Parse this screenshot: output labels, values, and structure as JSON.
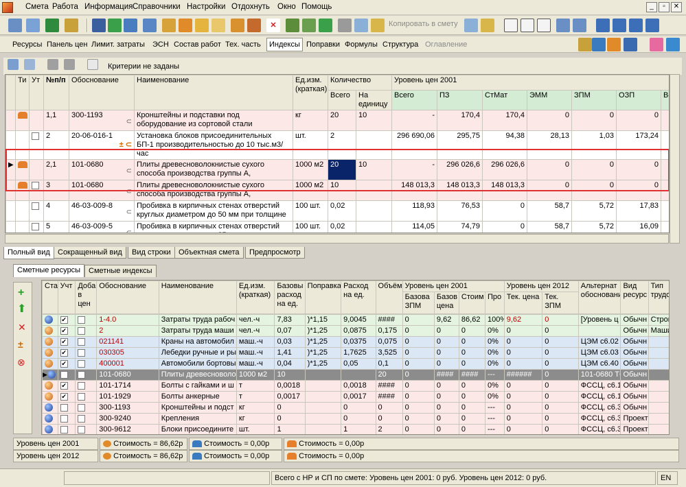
{
  "menu": [
    "Смета",
    "Работа",
    "Информация",
    "Справочники",
    "Настройки",
    "Отдохнуть",
    "Окно",
    "Помощь"
  ],
  "window_buttons": [
    "_",
    "▫",
    "✕"
  ],
  "toolbar": {
    "copy_label": "Копировать в смету"
  },
  "nav": {
    "items": [
      "Ресурсы",
      "Панель цен",
      "Лимит. затраты",
      "ЭСН",
      "Состав работ",
      "Тех. часть",
      "Индексы",
      "Поправки",
      "Формулы",
      "Структура",
      "Оглавление"
    ],
    "active": "Индексы",
    "disabled": "Оглавление"
  },
  "criteria_label": "Критерии не заданы",
  "upper": {
    "headers": {
      "ti": "Ти",
      "ut": "Ут",
      "npp": "№п/п",
      "obosn": "Обоснование",
      "name": "Наименование",
      "unit": "Ед.изм. (краткая)",
      "qty": "Количество",
      "qty_total": "Всего",
      "qty_per": "На единицу",
      "level": "Уровень цен 2001",
      "vsego": "Всего",
      "pz": "ПЗ",
      "stmat": "СтМат",
      "emm": "ЭММ",
      "zpm": "ЗПМ",
      "ozp": "ОЗП",
      "vo": "Во"
    },
    "rows": [
      {
        "npp": "1,1",
        "obosn": "300-1193",
        "name": "Кронштейны и подставки под оборудование из сортовой стали",
        "unit": "кг",
        "qty": "20",
        "per": "10",
        "vsego": "-",
        "pz": "170,4",
        "stmat": "170,4",
        "emm": "0",
        "zpm": "0",
        "ozp": "0"
      },
      {
        "npp": "2",
        "obosn": "20-06-016-1",
        "name": "Установка блоков присоединительных БП-1 производительностью до 10 тыс.м3/час",
        "unit": "шт.",
        "qty": "2",
        "per": "",
        "vsego": "296 690,06",
        "pz": "295,75",
        "stmat": "94,38",
        "emm": "28,13",
        "zpm": "1,03",
        "ozp": "173,24"
      },
      {
        "npp": "2,1",
        "obosn": "101-0680",
        "name": "Плиты древесноволокнистые сухого способа производства группы А,",
        "unit": "1000 м2",
        "qty": "20",
        "per": "10",
        "vsego": "-",
        "pz": "296 026,6",
        "stmat": "296 026,6",
        "emm": "0",
        "zpm": "0",
        "ozp": "0"
      },
      {
        "npp": "3",
        "obosn": "101-0680",
        "name": "Плиты древесноволокнистые сухого способа производства группы А,",
        "unit": "1000 м2",
        "qty": "10",
        "per": "",
        "vsego": "148 013,3",
        "pz": "148 013,3",
        "stmat": "148 013,3",
        "emm": "0",
        "zpm": "0",
        "ozp": "0"
      },
      {
        "npp": "4",
        "obosn": "46-03-009-8",
        "name": "Пробивка в кирпичных стенах отверстий круглых диаметром до 50 мм при толщине",
        "unit": "100 шт.",
        "qty": "0,02",
        "per": "",
        "vsego": "118,93",
        "pz": "76,53",
        "stmat": "0",
        "emm": "58,7",
        "zpm": "5,72",
        "ozp": "17,83"
      },
      {
        "npp": "5",
        "obosn": "46-03-009-5",
        "name": "Пробивка в кирпичных стенах отверстий круглых диаметром до 25 мм при толщине",
        "unit": "100 шт.",
        "qty": "0,02",
        "per": "",
        "vsego": "114,05",
        "pz": "74,79",
        "stmat": "0",
        "emm": "58,7",
        "zpm": "5,72",
        "ozp": "16,09"
      }
    ]
  },
  "view_tabs": [
    "Полный вид",
    "Сокращенный вид",
    "Вид строки",
    "Объектная смета",
    "Предпросмотр"
  ],
  "lower_tabs": [
    "Сметные ресурсы",
    "Сметные индексы"
  ],
  "lower": {
    "headers": {
      "stat": "Ста",
      "ucht": "Учт",
      "doba": "Доба в цен",
      "obosn": "Обоснование",
      "name": "Наименование",
      "unit": "Ед.изм. (краткая)",
      "base": "Базовы расход на ед.",
      "popr": "Поправка",
      "rashod": "Расход на ед.",
      "obem": "Объём",
      "lvl2001": "Уровень цен 2001",
      "bzpm": "Базова ЗПМ",
      "bprice": "Базов цена",
      "stoim": "Стоим",
      "pro": "Про",
      "lvl2012": "Уровень цен 2012",
      "tprice": "Тек. цена",
      "tzpm": "Тек. ЗПМ",
      "alt": "Альтернат обосновани",
      "vid": "Вид ресурс",
      "tip": "Тип трудоза"
    },
    "rows": [
      {
        "obosn": "1-4.0",
        "name": "Затраты труда рабоч",
        "unit": "чел.-ч",
        "base": "7,83",
        "popr": ")*1,15",
        "rashod": "9,0045",
        "obem": "####",
        "bzpm": "0",
        "bprice": "9,62",
        "stoim": "86,62",
        "pro": "100%",
        "tprice": "9,62",
        "tzpm": "0",
        "alt": "[Уровень ц",
        "vid": "Обычн",
        "tip": "Строите"
      },
      {
        "obosn": "2",
        "name": "Затраты труда маши",
        "unit": "чел.-ч",
        "base": "0,07",
        "popr": ")*1,25",
        "rashod": "0,0875",
        "obem": "0,175",
        "bzpm": "0",
        "bprice": "0",
        "stoim": "0",
        "pro": "0%",
        "tprice": "0",
        "tzpm": "0",
        "alt": "",
        "vid": "Обычн",
        "tip": "Машини"
      },
      {
        "obosn": "021141",
        "name": "Краны на автомобил",
        "unit": "маш.-ч",
        "base": "0,03",
        "popr": ")*1,25",
        "rashod": "0,0375",
        "obem": "0,075",
        "bzpm": "0",
        "bprice": "0",
        "stoim": "0",
        "pro": "0%",
        "tprice": "0",
        "tzpm": "0",
        "alt": "ЦЭМ с6.02",
        "vid": "Обычн",
        "tip": ""
      },
      {
        "obosn": "030305",
        "name": "Лебедки ручные и ры",
        "unit": "маш.-ч",
        "base": "1,41",
        "popr": ")*1,25",
        "rashod": "1,7625",
        "obem": "3,525",
        "bzpm": "0",
        "bprice": "0",
        "stoim": "0",
        "pro": "0%",
        "tprice": "0",
        "tzpm": "0",
        "alt": "ЦЭМ с6.03",
        "vid": "Обычн",
        "tip": ""
      },
      {
        "obosn": "400001",
        "name": "Автомобили бортовы",
        "unit": "маш.-ч",
        "base": "0,04",
        "popr": ")*1,25",
        "rashod": "0,05",
        "obem": "0,1",
        "bzpm": "0",
        "bprice": "0",
        "stoim": "0",
        "pro": "0%",
        "tprice": "0",
        "tzpm": "0",
        "alt": "ЦЭМ с6.40",
        "vid": "Обычн",
        "tip": ""
      },
      {
        "obosn": "101-0680",
        "name": "Плиты древесноволо",
        "unit": "1000 м2",
        "base": "10",
        "popr": "",
        "rashod": "",
        "obem": "20",
        "bzpm": "0",
        "bprice": "####",
        "stoim": "####",
        "pro": "---",
        "tprice": "######",
        "tzpm": "0",
        "alt": "101-0680 ТС",
        "vid": "Обычн",
        "tip": ""
      },
      {
        "obosn": "101-1714",
        "name": "Болты с гайками и ш",
        "unit": "т",
        "base": "0,0018",
        "popr": "",
        "rashod": "0,0018",
        "obem": "####",
        "bzpm": "0",
        "bprice": "0",
        "stoim": "0",
        "pro": "0%",
        "tprice": "0",
        "tzpm": "0",
        "alt": "ФССЦ, с6.1",
        "vid": "Обычн",
        "tip": ""
      },
      {
        "obosn": "101-1929",
        "name": "Болты анкерные",
        "unit": "т",
        "base": "0,0017",
        "popr": "",
        "rashod": "0,0017",
        "obem": "####",
        "bzpm": "0",
        "bprice": "0",
        "stoim": "0",
        "pro": "0%",
        "tprice": "0",
        "tzpm": "0",
        "alt": "ФССЦ, с6.1",
        "vid": "Обычн",
        "tip": ""
      },
      {
        "obosn": "300-1193",
        "name": "Кронштейны и подст",
        "unit": "кг",
        "base": "0",
        "popr": "",
        "rashod": "0",
        "obem": "0",
        "bzpm": "0",
        "bprice": "0",
        "stoim": "0",
        "pro": "---",
        "tprice": "0",
        "tzpm": "0",
        "alt": "ФССЦ, с6.3",
        "vid": "Обычн",
        "tip": ""
      },
      {
        "obosn": "300-9240",
        "name": "Крепления",
        "unit": "кг",
        "base": "0",
        "popr": "",
        "rashod": "0",
        "obem": "0",
        "bzpm": "0",
        "bprice": "0",
        "stoim": "0",
        "pro": "---",
        "tprice": "0",
        "tzpm": "0",
        "alt": "ФССЦ, с6.3",
        "vid": "Проект",
        "tip": ""
      },
      {
        "obosn": "300-9612",
        "name": "Блоки присоедините",
        "unit": "шт.",
        "base": "1",
        "popr": "",
        "rashod": "1",
        "obem": "2",
        "bzpm": "0",
        "bprice": "0",
        "stoim": "0",
        "pro": "---",
        "tprice": "0",
        "tzpm": "0",
        "alt": "ФССЦ, с6.3",
        "vid": "Проект",
        "tip": ""
      }
    ]
  },
  "status": {
    "row1": {
      "level": "Уровень цен 2001",
      "s1": "Стоимость = 86,62р",
      "s2": "Стоимость = 0,00р",
      "s3": "Стоимость = 0,00р"
    },
    "row2": {
      "level": "Уровень цен 2012",
      "s1": "Стоимость = 86,62р",
      "s2": "Стоимость = 0,00р",
      "s3": "Стоимость = 0,00р"
    }
  },
  "bottom": {
    "summary": "Всего с НР и СП по смете: Уровень цен 2001: 0 руб. Уровень цен 2012: 0 руб.",
    "lang": "EN"
  }
}
